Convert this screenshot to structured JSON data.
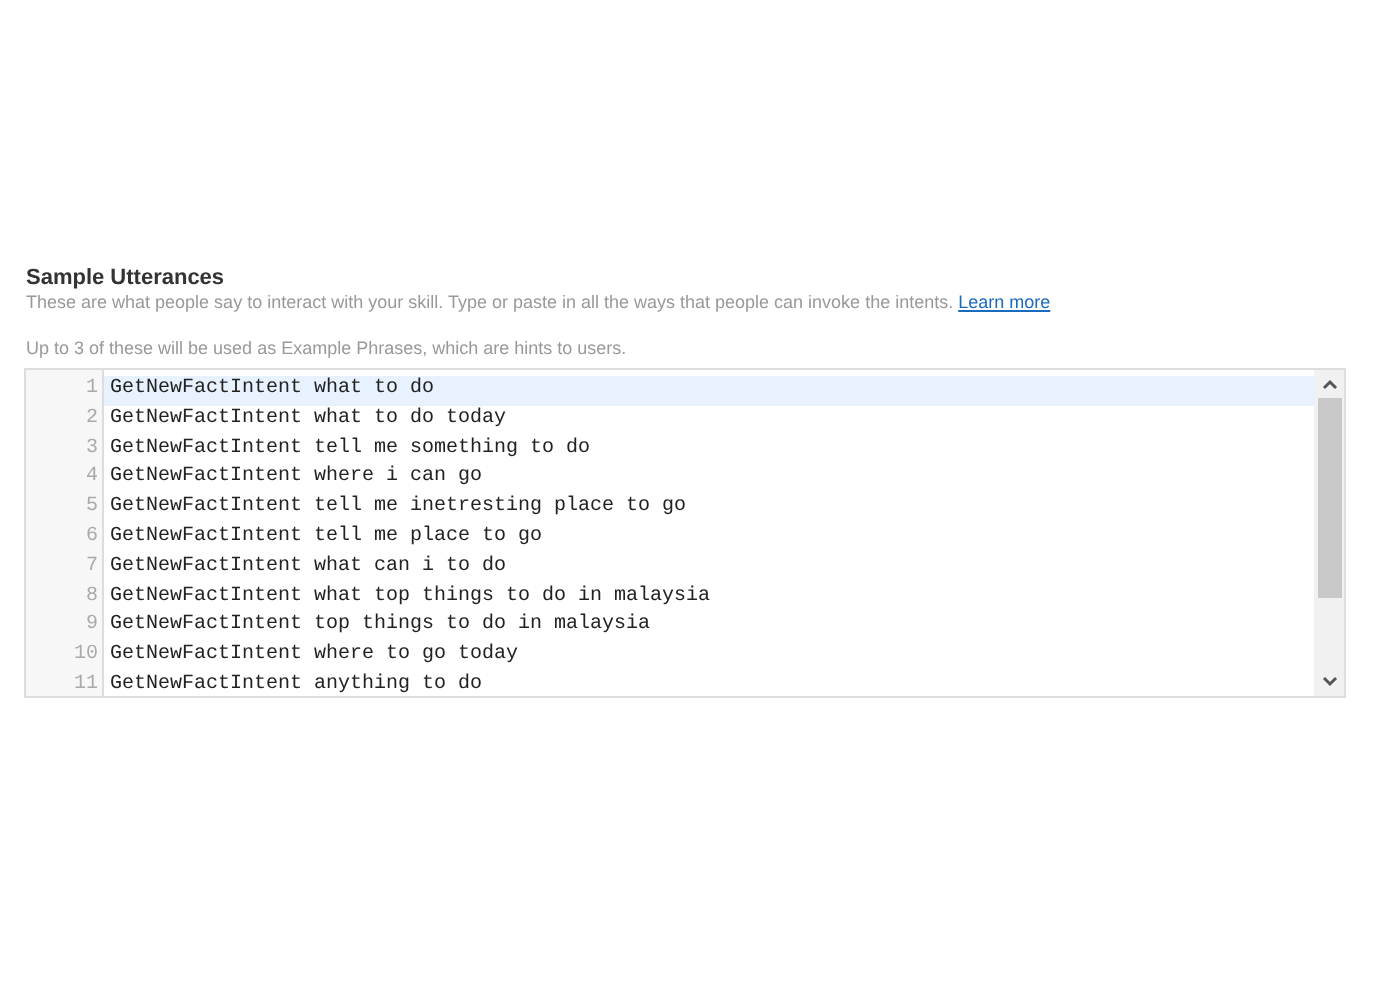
{
  "section": {
    "title": "Sample Utterances",
    "description": "These are what people say to interact with your skill. Type or paste in all the ways that people can invoke the intents.",
    "link": "Learn more",
    "hint": "Up to 3 of these will be used as Example Phrases, which are hints to users."
  },
  "editor": {
    "lines": [
      {
        "number": "1",
        "text": "GetNewFactIntent what to do",
        "selected": true
      },
      {
        "number": "2",
        "text": "GetNewFactIntent what to do today",
        "selected": false
      },
      {
        "number": "3",
        "text": "GetNewFactIntent tell me something to do",
        "selected": false
      },
      {
        "number": "4",
        "text": "GetNewFactIntent where i can go",
        "selected": false
      },
      {
        "number": "5",
        "text": "GetNewFactIntent tell me inetresting place to go",
        "selected": false
      },
      {
        "number": "6",
        "text": "GetNewFactIntent tell me place to go",
        "selected": false
      },
      {
        "number": "7",
        "text": "GetNewFactIntent what can i to do",
        "selected": false
      },
      {
        "number": "8",
        "text": "GetNewFactIntent what top things to do in malaysia",
        "selected": false
      },
      {
        "number": "9",
        "text": "GetNewFactIntent top things to do in malaysia",
        "selected": false
      },
      {
        "number": "10",
        "text": "GetNewFactIntent where to go today",
        "selected": false
      },
      {
        "number": "11",
        "text": "GetNewFactIntent anything to do",
        "selected": false
      }
    ]
  }
}
